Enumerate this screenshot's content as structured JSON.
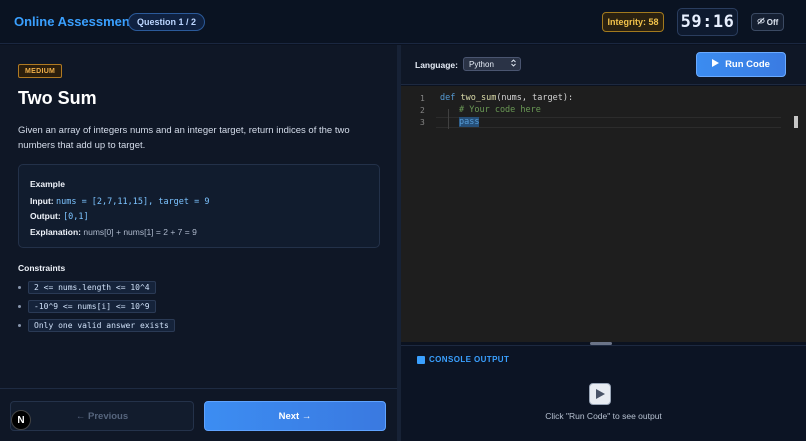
{
  "header": {
    "title": "Online Assessment",
    "question_pill": "Question 1 / 2",
    "integrity": "Integrity: 58",
    "timer": "59:16",
    "toggle_label": "Off"
  },
  "problem": {
    "difficulty": "MEDIUM",
    "title": "Two Sum",
    "description": "Given an array of integers nums and an integer target, return indices of the two numbers that add up to target.",
    "example": {
      "heading": "Example",
      "input_label": "Input:",
      "input_value": "nums = [2,7,11,15], target = 9",
      "output_label": "Output:",
      "output_value": "[0,1]",
      "explanation_label": "Explanation:",
      "explanation_value": "nums[0] + nums[1] = 2 + 7 = 9"
    },
    "constraints_heading": "Constraints",
    "constraints": [
      "2 <= nums.length <= 10^4",
      "-10^9 <= nums[i] <= 10^9",
      "Only one valid answer exists"
    ]
  },
  "nav": {
    "previous": "← Previous",
    "next": "Next →"
  },
  "editor": {
    "language_label": "Language:",
    "language_selected": "Python",
    "run_label": "Run Code",
    "lines": [
      {
        "num": "1",
        "kw": "def ",
        "fn": "two_sum",
        "rest": "(nums, target):"
      },
      {
        "num": "2",
        "comment": "# Your code here"
      },
      {
        "num": "3",
        "pass": "pass"
      }
    ]
  },
  "console": {
    "title": "CONSOLE OUTPUT",
    "hint": "Click \"Run Code\" to see output"
  },
  "colors": {
    "accent": "#3aa0ff",
    "primary_button": "#3b8cf0",
    "warning": "#f2c24b",
    "difficulty": "#f0b04a"
  }
}
